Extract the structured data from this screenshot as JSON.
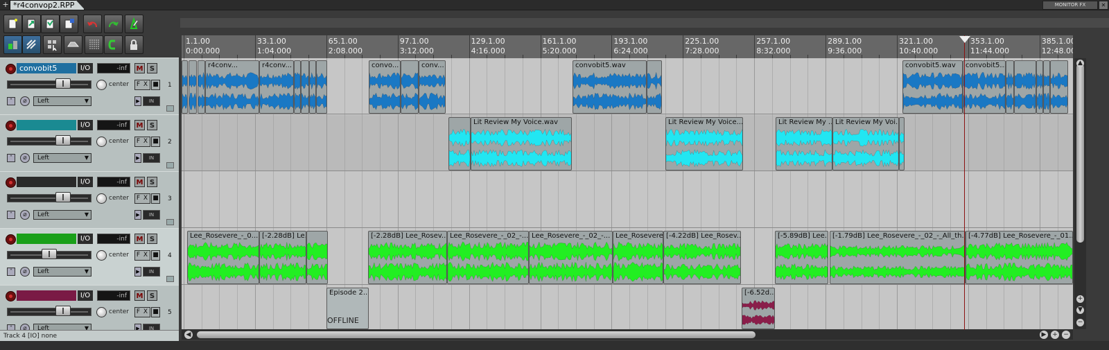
{
  "window": {
    "project_tab": "*r4convop2.RPP",
    "plus": "+",
    "monitor_fx": "MONITOR FX",
    "monitor_close": "✕"
  },
  "toolbar": {
    "icons": [
      "new-project-icon",
      "open-project-icon",
      "save-project-icon",
      "project-settings-icon",
      "undo-icon",
      "redo-icon",
      "metronome-icon",
      "grid-snap-icon",
      "ripple-edit-icon",
      "item-grouping-icon",
      "envelope-lock-icon",
      "auto-crossfade-icon",
      "loop-icon",
      "lock-icon"
    ]
  },
  "tracks": [
    {
      "number": "1",
      "name": "convobit5",
      "name_color": "#1f6fa0",
      "volume": "-inf",
      "mute": "M",
      "solo": "S",
      "pan": "center",
      "fx": "F X",
      "input": "Left",
      "in_label": "IN",
      "io": "I/O",
      "fader_pos": 0.64
    },
    {
      "number": "2",
      "name": "",
      "name_color": "#1a8a92",
      "volume": "-inf",
      "mute": "M",
      "solo": "S",
      "pan": "center",
      "fx": "F X",
      "input": "Left",
      "in_label": "IN",
      "io": "I/O",
      "fader_pos": 0.64
    },
    {
      "number": "3",
      "name": "",
      "name_color": "#2a2a2a",
      "volume": "-inf",
      "mute": "M",
      "solo": "S",
      "pan": "center",
      "fx": "F X",
      "input": "Left",
      "in_label": "IN",
      "io": "I/O",
      "fader_pos": 0.64
    },
    {
      "number": "4",
      "name": "",
      "name_color": "#1aa01a",
      "volume": "-inf",
      "mute": "M",
      "solo": "S",
      "pan": "center",
      "fx": "F X",
      "input": "Left",
      "in_label": "IN",
      "io": "I/O",
      "fader_pos": 0.45
    },
    {
      "number": "5",
      "name": "",
      "name_color": "#7a1a45",
      "volume": "-inf",
      "mute": "M",
      "solo": "S",
      "pan": "center",
      "fx": "F X",
      "input": "Left",
      "in_label": "IN",
      "io": "I/O",
      "fader_pos": 0.64
    }
  ],
  "status_bar": "Track 4 [IO] none",
  "ruler": {
    "marks": [
      {
        "measure": "1.1.00",
        "time": "0:00.000"
      },
      {
        "measure": "33.1.00",
        "time": "1:04.000"
      },
      {
        "measure": "65.1.00",
        "time": "2:08.000"
      },
      {
        "measure": "97.1.00",
        "time": "3:12.000"
      },
      {
        "measure": "129.1.00",
        "time": "4:16.000"
      },
      {
        "measure": "161.1.00",
        "time": "5:20.000"
      },
      {
        "measure": "193.1.00",
        "time": "6:24.000"
      },
      {
        "measure": "225.1.00",
        "time": "7:28.000"
      },
      {
        "measure": "257.1.00",
        "time": "8:32.000"
      },
      {
        "measure": "289.1.00",
        "time": "9:36.000"
      },
      {
        "measure": "321.1.00",
        "time": "10:40.000"
      },
      {
        "measure": "353.1.00",
        "time": "11:44.000"
      },
      {
        "measure": "385.1.00",
        "time": "12:48.000"
      }
    ]
  },
  "colors": {
    "track1_wave": "#1a78c4",
    "track2_wave": "#22e6f2",
    "track4_wave": "#22ee22",
    "track5_wave": "#8a1e4a",
    "playhead": "#8a1010"
  },
  "items": {
    "lane1": [
      {
        "label": "",
        "w": "narrow"
      },
      {
        "label": "r4conv..."
      },
      {
        "label": "r4conv..."
      },
      {
        "label": "convo..."
      },
      {
        "label": "conv..."
      },
      {
        "label": "convobit5.wav"
      },
      {
        "label": "convobit5.wav"
      },
      {
        "label": "convobit5..."
      }
    ],
    "lane2": [
      {
        "label": "Lit Review My Voice.wav"
      },
      {
        "label": "Lit Review My Voice...."
      },
      {
        "label": "Lit Review My ..."
      },
      {
        "label": "Lit Review My Voi..."
      }
    ],
    "lane4": [
      {
        "label": "Lee_Rosevere_-_0..."
      },
      {
        "label": "[-2.28dB] Le..."
      },
      {
        "label": "[-2.28dB] Lee_Rosev..."
      },
      {
        "label": "Lee_Rosevere_-_02_-..."
      },
      {
        "label": "Lee_Rosevere_-_02_-..."
      },
      {
        "label": "Lee_Rosevere..."
      },
      {
        "label": "[-4.22dB] Lee_Rosev..."
      },
      {
        "label": "[-5.89dB] Lee..."
      },
      {
        "label": "[-1.79dB] Lee_Rosevere_-_02_-_All_th..."
      },
      {
        "label": "[-4.77dB] Lee_Rosevere_-_01..."
      }
    ],
    "lane5": [
      {
        "label": "Episode 2...",
        "offline": "OFFLINE"
      },
      {
        "label": "[-6.52d..."
      }
    ]
  },
  "scroll": {
    "up": "▲",
    "down": "▼",
    "plus": "+",
    "minus": "−",
    "left": "◀",
    "right": "▶"
  }
}
